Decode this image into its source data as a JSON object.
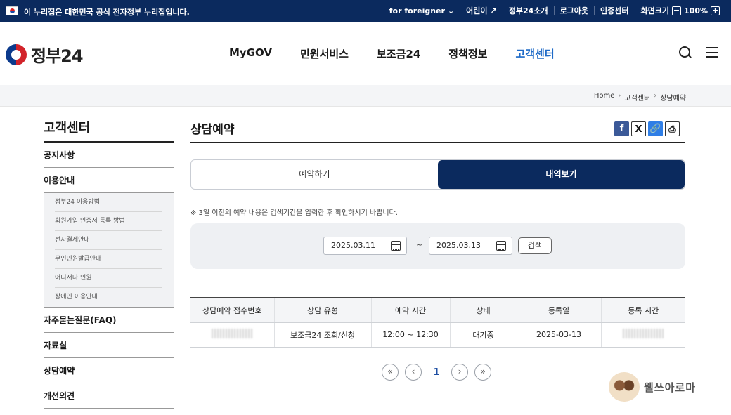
{
  "topbar": {
    "notice": "이 누리집은 대한민국 공식 전자정부 누리집입니다.",
    "links": [
      "for foreigner",
      "어린이",
      "정부24소개",
      "로그아웃",
      "인증센터"
    ],
    "zoom_label": "화면크기",
    "zoom_value": "100%",
    "zoom_minus": "−",
    "zoom_plus": "+"
  },
  "header": {
    "logo_text": "정부24",
    "nav": [
      "MyGOV",
      "민원서비스",
      "보조금24",
      "정책정보",
      "고객센터"
    ],
    "active_nav": "고객센터"
  },
  "breadcrumb": [
    "Home",
    "고객센터",
    "상담예약"
  ],
  "sidebar": {
    "title": "고객센터",
    "items_top": [
      "공지사항",
      "이용안내"
    ],
    "sub_items": [
      "정부24 이용방법",
      "회원가입·인증서 등록 방법",
      "전자결제안내",
      "무인민원발급안내",
      "어디서나 민원",
      "장애인 이용안내"
    ],
    "items_bottom": [
      "자주묻는질문(FAQ)",
      "자료실",
      "상담예약",
      "개선의견"
    ]
  },
  "content": {
    "title": "상담예약",
    "tabs": [
      "예약하기",
      "내역보기"
    ],
    "active_tab": "내역보기",
    "note": "※ 3일 이전의 예약 내용은 검색기간을 입력한 후 확인하시기 바랍니다.",
    "date_from": "2025.03.11",
    "date_to": "2025.03.13",
    "tilde": "~",
    "search_label": "검색",
    "table": {
      "headers": [
        "상담예약 접수번호",
        "상담 유형",
        "예약 시간",
        "상태",
        "등록일",
        "등록 시간"
      ],
      "rows": [
        {
          "type": "보조금24 조회/신청",
          "time": "12:00 ~ 12:30",
          "status": "대기중",
          "date": "2025-03-13"
        }
      ]
    },
    "pager": {
      "first": "«",
      "prev": "‹",
      "page": "1",
      "next": "›",
      "last": "»"
    }
  },
  "share": {
    "facebook": "f",
    "x": "X",
    "link": "🔗",
    "print": "⎙"
  },
  "watermark": "웰쓰아로마",
  "colors": {
    "navy": "#0b2a5e",
    "accent": "#1e6ac7"
  }
}
